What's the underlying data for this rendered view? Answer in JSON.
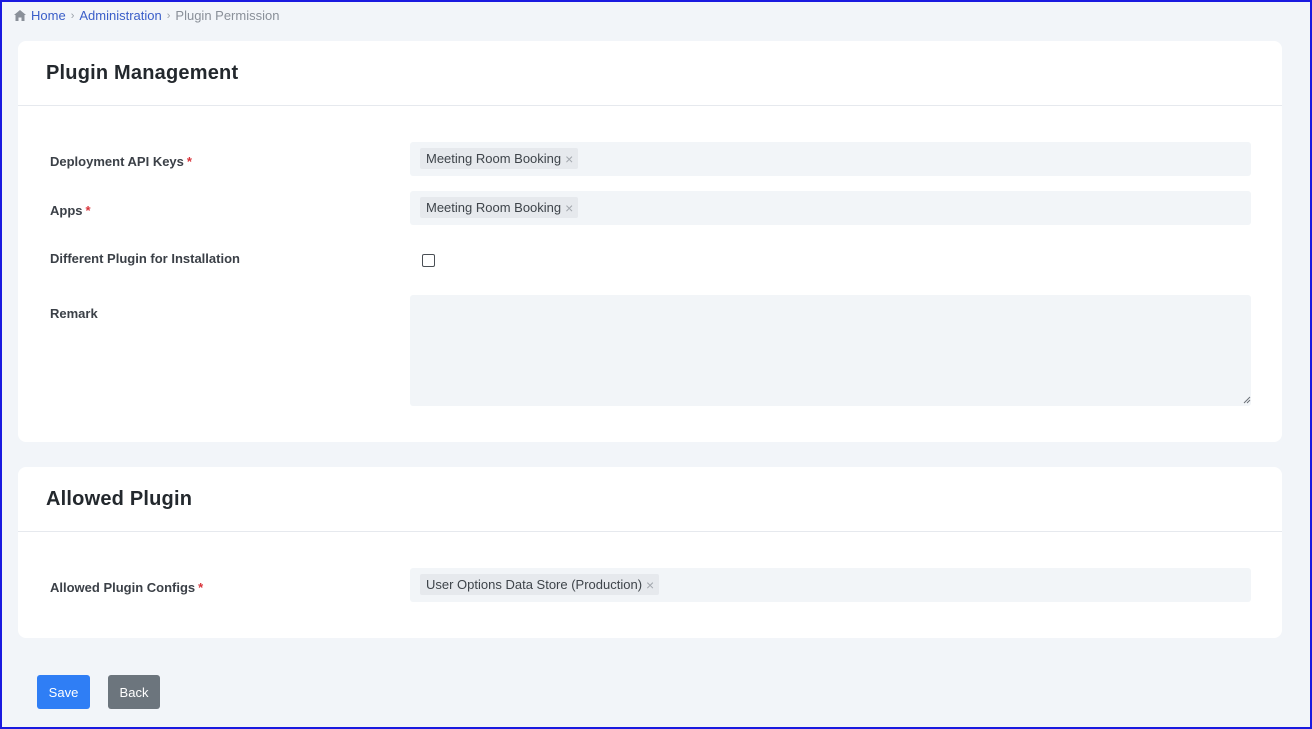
{
  "breadcrumb": {
    "home": "Home",
    "admin": "Administration",
    "current": "Plugin Permission"
  },
  "plugin_management": {
    "title": "Plugin Management",
    "deployment_api_keys": {
      "label": "Deployment API Keys",
      "required_mark": "*",
      "tags": [
        "Meeting Room Booking"
      ]
    },
    "apps": {
      "label": "Apps",
      "required_mark": "*",
      "tags": [
        "Meeting Room Booking"
      ]
    },
    "different_plugin": {
      "label": "Different Plugin for Installation",
      "checked": false
    },
    "remark": {
      "label": "Remark",
      "value": ""
    }
  },
  "allowed_plugin": {
    "title": "Allowed Plugin",
    "configs": {
      "label": "Allowed Plugin Configs",
      "required_mark": "*",
      "tags": [
        "User Options Data Store (Production)"
      ]
    }
  },
  "actions": {
    "save_label": "Save",
    "back_label": "Back"
  },
  "colors": {
    "primary": "#2f7ef5",
    "secondary": "#6c757d",
    "link": "#3a5ec8",
    "required": "#d9343b",
    "page_bg": "#f2f5f9"
  },
  "icons": {
    "home": "home-icon",
    "tag_remove": "close-icon"
  }
}
